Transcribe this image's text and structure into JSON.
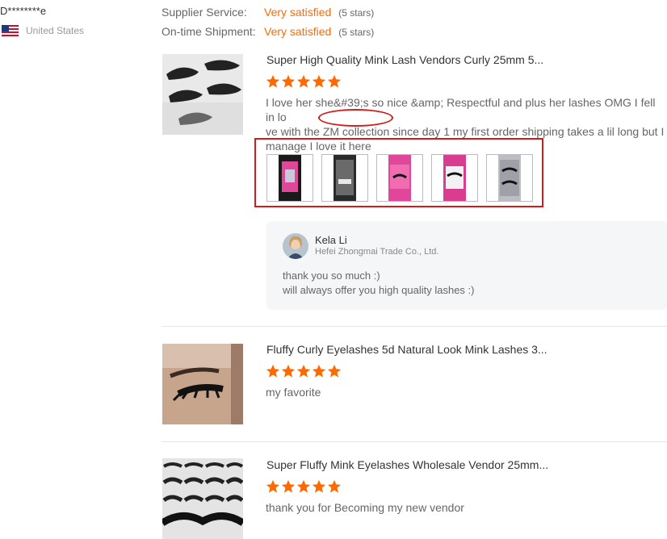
{
  "reviewer": {
    "name": "D********e",
    "country": "United States"
  },
  "ratings": [
    {
      "label": "Supplier Service:",
      "value": "Very satisfied",
      "count": "(5 stars)"
    },
    {
      "label": "On-time Shipment:",
      "value": "Very satisfied",
      "count": "(5 stars)"
    }
  ],
  "colors": {
    "accent": "#ff6a00",
    "highlight": "#d21b1b"
  },
  "reviews": [
    {
      "title": "Super High Quality Mink Lash Vendors Curly 25mm 5...",
      "stars": 5,
      "text_lines": [
        "I love her she&#39;s so nice &amp; Respectful and plus her lashes OMG I fell in lo",
        "ve with the ZM collection since day 1 my first order shipping takes a lil long but I",
        "manage I love it here"
      ],
      "photos": [
        "photo-1",
        "photo-2",
        "photo-3",
        "photo-4",
        "photo-5"
      ],
      "reply": {
        "name": "Kela Li",
        "company": "Hefei Zhongmai Trade Co., Ltd.",
        "lines": [
          "thank you so much :)",
          "will always offer you high quality lashes :)"
        ]
      }
    },
    {
      "title": "Fluffy Curly Eyelashes 5d Natural Look Mink Lashes 3...",
      "stars": 5,
      "text_lines": [
        "my favorite"
      ]
    },
    {
      "title": "Super Fluffy Mink Eyelashes Wholesale Vendor 25mm...",
      "stars": 5,
      "text_lines": [
        "thank you for Becoming my new vendor"
      ]
    }
  ]
}
